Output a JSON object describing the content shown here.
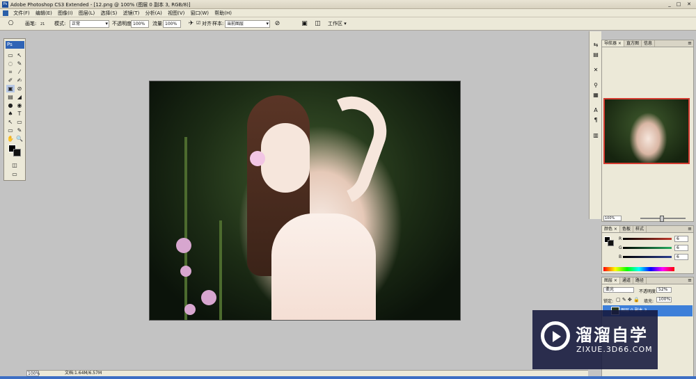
{
  "window": {
    "title": "Adobe Photoshop CS3 Extended - [12.png @ 100% (图层 0 副本 3, RGB/8)]",
    "controls": [
      "_",
      "□",
      "✕"
    ]
  },
  "menubar": {
    "items": [
      "文件(F)",
      "编辑(E)",
      "图像(I)",
      "图层(L)",
      "选择(S)",
      "滤镜(T)",
      "分析(A)",
      "视图(V)",
      "窗口(W)",
      "帮助(H)"
    ]
  },
  "options": {
    "brush_label": "画笔:",
    "brush_size": "21",
    "mode_label": "模式:",
    "mode_value": "正常",
    "opacity_label": "不透明度:",
    "opacity_value": "100%",
    "flow_label": "流量:",
    "flow_value": "100%",
    "align_label": "对齐",
    "sample_label": "样本:",
    "sample_value": "当前图层",
    "workspace_label": "工作区 ▾"
  },
  "toolbox": {
    "badge": "Ps",
    "tools": [
      "▭",
      "↖",
      "◌",
      "✎",
      "⌗",
      "⁄",
      "✐",
      "✍",
      "▣",
      "⊘",
      "▤",
      "◢",
      "●",
      "◉",
      "♠",
      "T",
      "↖",
      "▭",
      "▭",
      "✎",
      "✋",
      "🔍",
      "◫",
      "▭"
    ]
  },
  "statusbar": {
    "zoom": "100%",
    "doc_info": "文档:1.64M/6.57M"
  },
  "dock": {
    "icons": [
      "⇆",
      "▤",
      "✕",
      "⚲",
      "▦",
      "A",
      "¶",
      "▥"
    ]
  },
  "navigator_panel": {
    "tabs": [
      "导航器 ×",
      "直方图",
      "信息"
    ],
    "zoom": "100%"
  },
  "color_panel": {
    "tabs": [
      "颜色 ×",
      "色板",
      "样式"
    ],
    "channels": [
      {
        "label": "R",
        "value": "6",
        "color": "#c0392b"
      },
      {
        "label": "G",
        "value": "6",
        "color": "#27ae60"
      },
      {
        "label": "B",
        "value": "6",
        "color": "#2c3e90"
      }
    ]
  },
  "layers_panel": {
    "tabs": [
      "图层 ×",
      "通道",
      "路径"
    ],
    "blend_mode": "柔光",
    "opacity_label": "不透明度:",
    "opacity_value": "52%",
    "lock_label": "锁定:",
    "fill_label": "填充:",
    "fill_value": "100%",
    "active_layer": "图层 0 副本 3"
  },
  "watermark": {
    "brand": "溜溜自学",
    "site": "ZIXUE.3D66.COM"
  }
}
